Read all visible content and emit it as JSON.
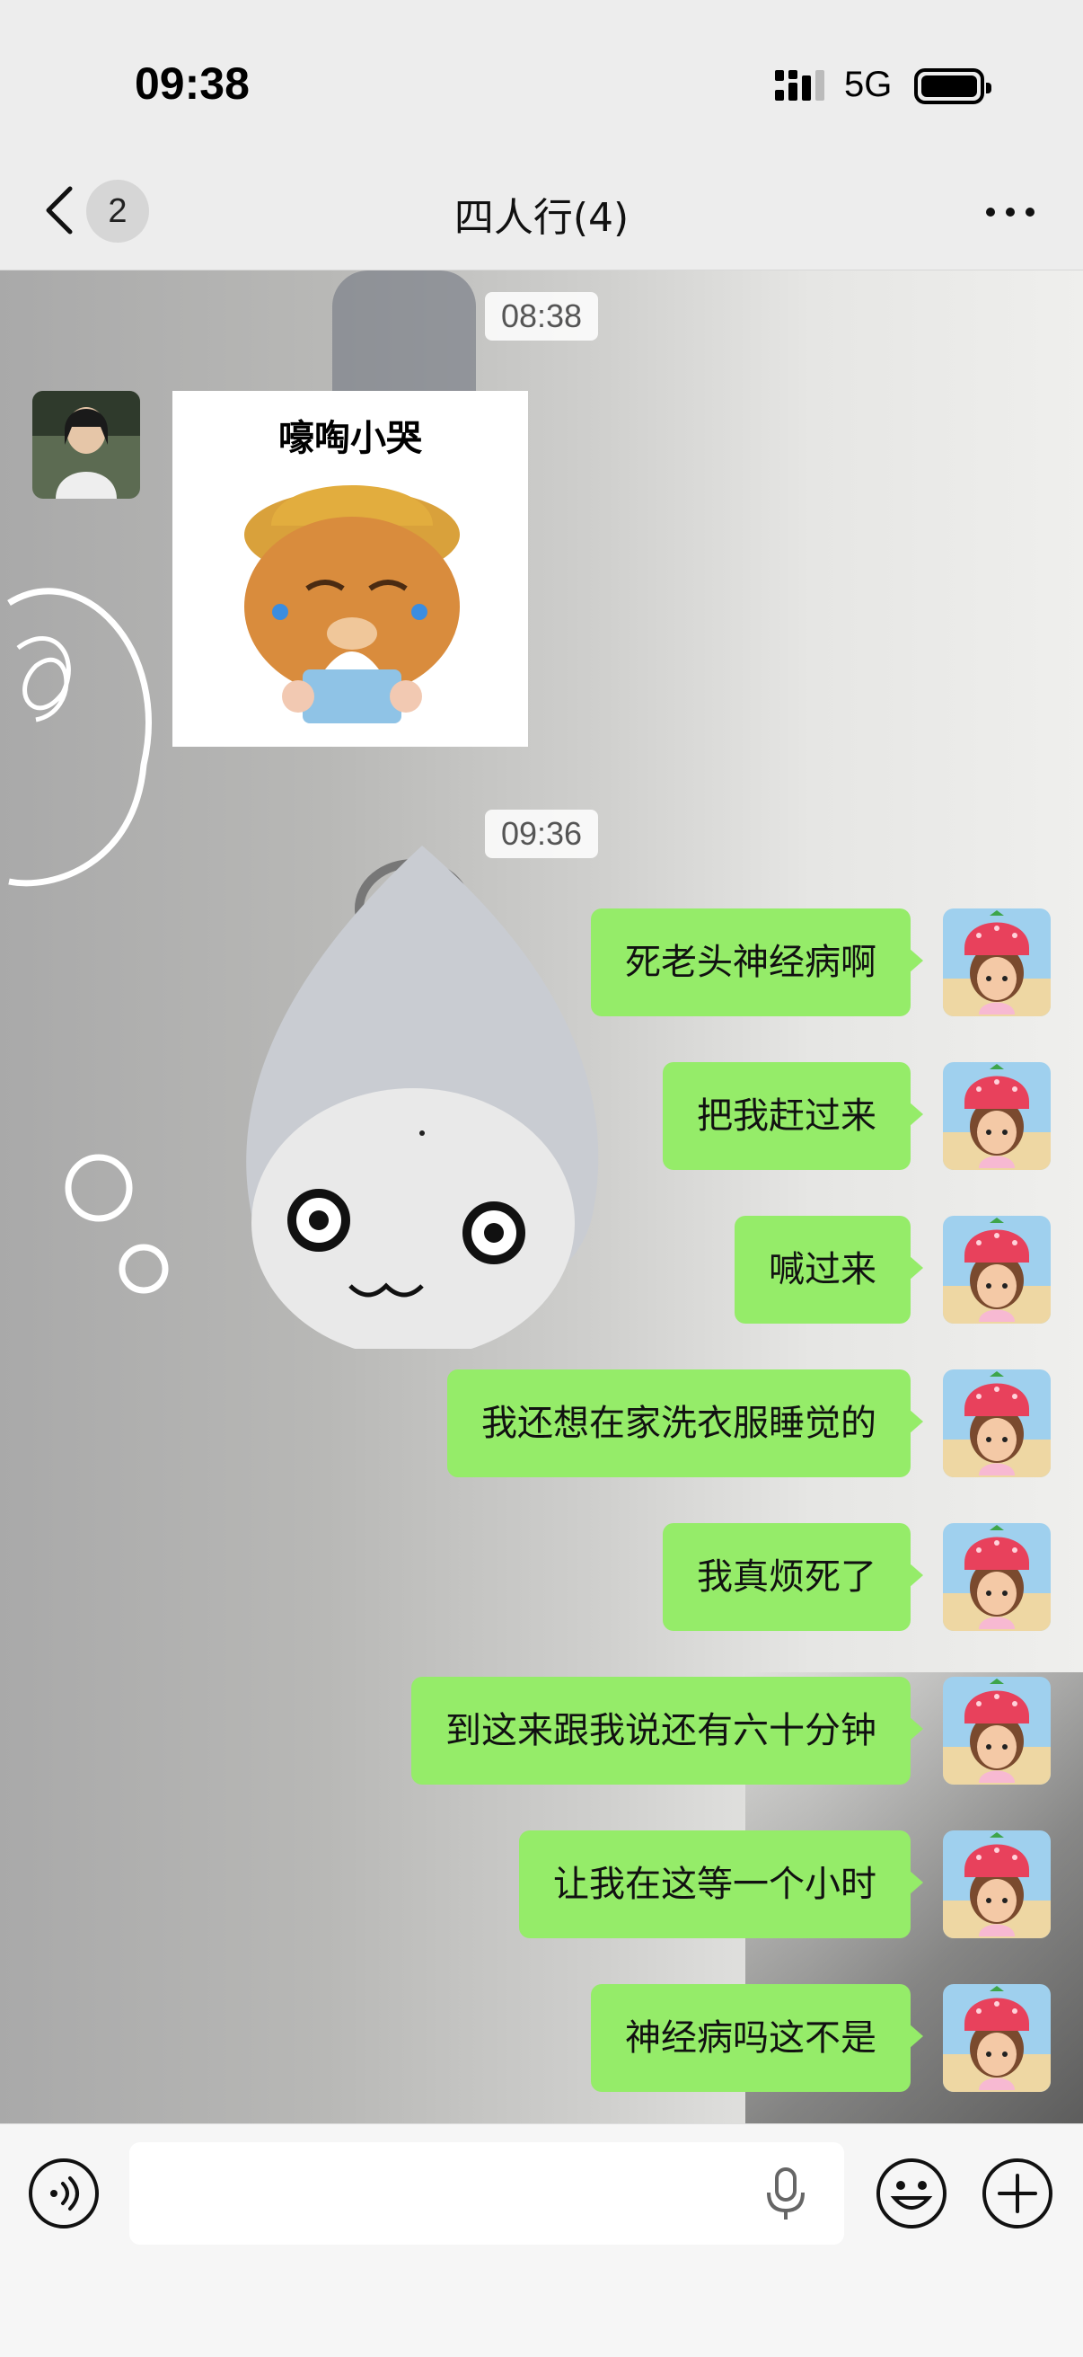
{
  "status_bar": {
    "time": "09:38",
    "network": "5G"
  },
  "nav": {
    "back_badge": "2",
    "title": "四人行(4)"
  },
  "messages": [
    {
      "type": "time",
      "text": "08:38"
    },
    {
      "type": "sticker",
      "side": "left",
      "sticker_text": "嚎啕小哭"
    },
    {
      "type": "time",
      "text": "09:36"
    },
    {
      "type": "text",
      "side": "right",
      "text": "死老头神经病啊"
    },
    {
      "type": "text",
      "side": "right",
      "text": "把我赶过来"
    },
    {
      "type": "text",
      "side": "right",
      "text": "喊过来"
    },
    {
      "type": "text",
      "side": "right",
      "text": "我还想在家洗衣服睡觉的"
    },
    {
      "type": "text",
      "side": "right",
      "text": "我真烦死了"
    },
    {
      "type": "text",
      "side": "right",
      "text": "到这来跟我说还有六十分钟"
    },
    {
      "type": "text",
      "side": "right",
      "text": "让我在这等一个小时"
    },
    {
      "type": "text",
      "side": "right",
      "text": "神经病吗这不是"
    }
  ],
  "input": {
    "value": "",
    "placeholder": ""
  },
  "colors": {
    "bubble_self": "#95ec69",
    "nav_bg": "#ededed"
  }
}
